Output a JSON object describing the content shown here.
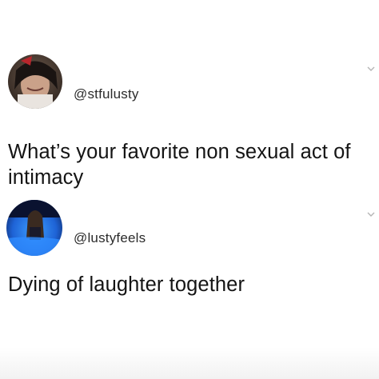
{
  "tweets": [
    {
      "handle": "@stfulusty",
      "text": "What’s your favorite non sexual act of intimacy",
      "avatar_icon": "user-avatar-dark",
      "chevron_icon": "chevron-down-icon"
    },
    {
      "handle": "@lustyfeels",
      "text": "Dying of laughter together",
      "avatar_icon": "user-avatar-pool",
      "chevron_icon": "chevron-down-icon"
    }
  ],
  "colors": {
    "text": "#141414",
    "handle": "#2b2b2b",
    "pool_blue": "#1e63d6",
    "background": "#ffffff"
  }
}
